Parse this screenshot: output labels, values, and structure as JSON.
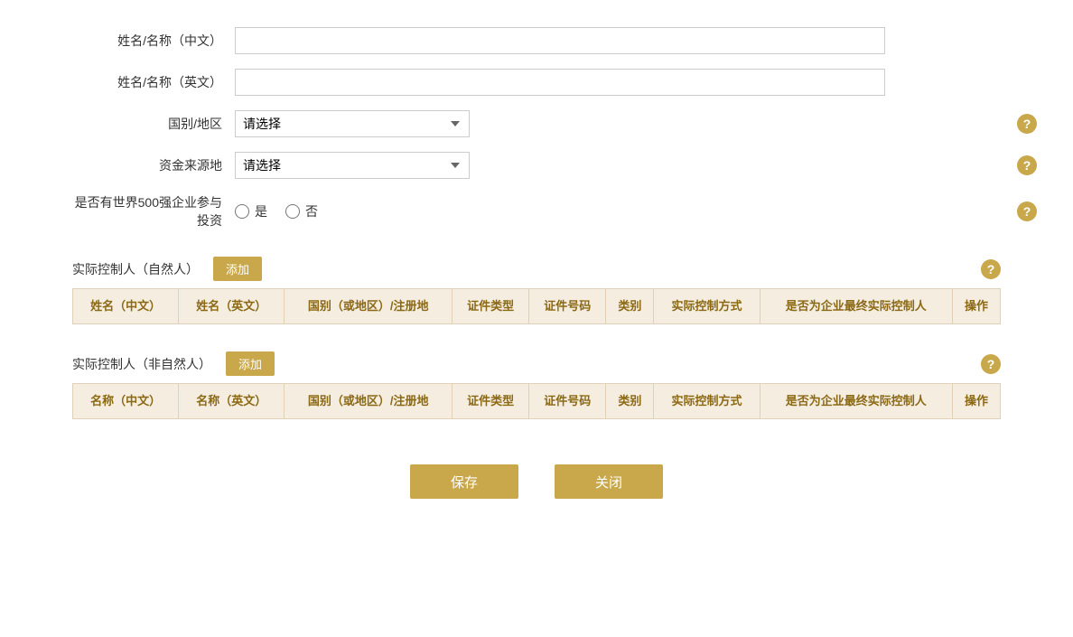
{
  "form": {
    "name_cn_label": "姓名/名称（中文）",
    "name_en_label": "姓名/名称（英文）",
    "country_label": "国别/地区",
    "fund_source_label": "资金来源地",
    "fortune500_label": "是否有世界500强企业参与投资",
    "country_placeholder": "请选择",
    "fund_source_placeholder": "请选择",
    "radio_yes": "是",
    "radio_no": "否",
    "name_cn_value": "",
    "name_en_value": ""
  },
  "natural_person": {
    "title": "实际控制人（自然人）",
    "add_btn": "添加",
    "columns": [
      "姓名（中文）",
      "姓名（英文）",
      "国别（或地区）/注册地",
      "证件类型",
      "证件号码",
      "类别",
      "实际控制方式",
      "是否为企业最终实际控制人",
      "操作"
    ]
  },
  "non_natural_person": {
    "title": "实际控制人（非自然人）",
    "add_btn": "添加",
    "columns": [
      "名称（中文）",
      "名称（英文）",
      "国别（或地区）/注册地",
      "证件类型",
      "证件号码",
      "类别",
      "实际控制方式",
      "是否为企业最终实际控制人",
      "操作"
    ]
  },
  "buttons": {
    "save": "保存",
    "close": "关闭"
  }
}
